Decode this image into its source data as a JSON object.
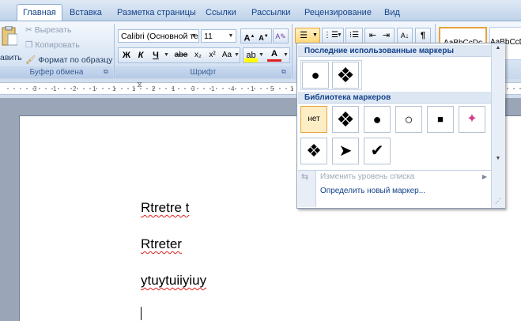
{
  "tabs": [
    "Главная",
    "Вставка",
    "Разметка страницы",
    "Ссылки",
    "Рассылки",
    "Рецензирование",
    "Вид"
  ],
  "clipboard": {
    "paste_label": "авить",
    "cut": "Вырезать",
    "copy": "Копировать",
    "format_painter": "Формат по образцу",
    "group_label": "Буфер обмена"
  },
  "font": {
    "family": "Calibri (Основной те",
    "size": "11",
    "group_label": "Шрифт",
    "bold": "Ж",
    "italic": "К",
    "underline": "Ч",
    "strike": "abe",
    "subscript": "x₂",
    "superscript": "x²",
    "case": "Aa",
    "grow": "A",
    "shrink": "A"
  },
  "styles": {
    "sample1": "AaBbCcDc",
    "sample2": "AaBbCcD"
  },
  "ruler": {
    "ticks": [
      "3",
      "1",
      "2",
      "1",
      "1",
      "1",
      "2",
      "1",
      "3",
      "1",
      "4",
      "1",
      "5",
      "1",
      "6",
      "1",
      "7",
      "1",
      "8",
      "1",
      "9",
      "1",
      "10"
    ]
  },
  "bullet_menu": {
    "recent_header": "Последние использованные маркеры",
    "recent": [
      {
        "icon": "filled-circle-bullet-icon",
        "glyph": "●"
      },
      {
        "icon": "ornament-bullet-icon",
        "glyph": "❖"
      }
    ],
    "library_header": "Библиотека маркеров",
    "library": [
      {
        "icon": "none-bullet",
        "glyph": "нет"
      },
      {
        "icon": "ornament-bullet-icon",
        "glyph": "❖"
      },
      {
        "icon": "filled-circle-bullet-icon",
        "glyph": "●"
      },
      {
        "icon": "hollow-circle-bullet-icon",
        "glyph": "○"
      },
      {
        "icon": "square-bullet-icon",
        "glyph": "■"
      },
      {
        "icon": "colored-star-bullet-icon",
        "glyph": "✦"
      },
      {
        "icon": "diamond-cluster-bullet-icon",
        "glyph": "❖"
      },
      {
        "icon": "arrowhead-bullet-icon",
        "glyph": "➤"
      },
      {
        "icon": "checkmark-bullet-icon",
        "glyph": "✔"
      }
    ],
    "change_level": "Изменить уровень списка",
    "define_new": "Определить новый маркер..."
  },
  "document": {
    "lines": [
      "Rtretre t",
      "Rtreter",
      "ytuytuiiyiuy"
    ]
  },
  "colors": {
    "ribbon_text": "#15428b",
    "selection": "#fdeec6",
    "spell_underline": "#e02020"
  }
}
